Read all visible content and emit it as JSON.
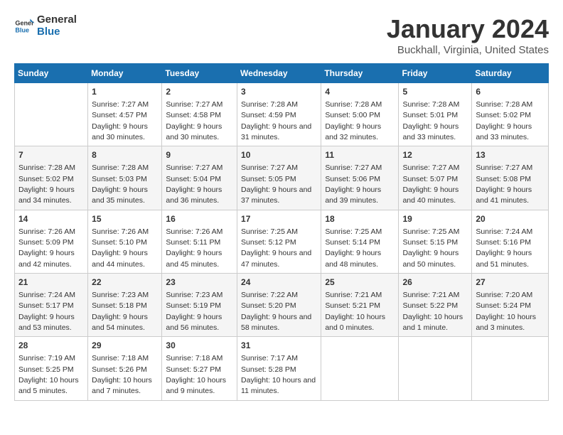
{
  "header": {
    "logo_line1": "General",
    "logo_line2": "Blue",
    "title": "January 2024",
    "subtitle": "Buckhall, Virginia, United States"
  },
  "calendar": {
    "weekdays": [
      "Sunday",
      "Monday",
      "Tuesday",
      "Wednesday",
      "Thursday",
      "Friday",
      "Saturday"
    ],
    "weeks": [
      [
        {
          "day": "",
          "sunrise": "",
          "sunset": "",
          "daylight": ""
        },
        {
          "day": "1",
          "sunrise": "Sunrise: 7:27 AM",
          "sunset": "Sunset: 4:57 PM",
          "daylight": "Daylight: 9 hours and 30 minutes."
        },
        {
          "day": "2",
          "sunrise": "Sunrise: 7:27 AM",
          "sunset": "Sunset: 4:58 PM",
          "daylight": "Daylight: 9 hours and 30 minutes."
        },
        {
          "day": "3",
          "sunrise": "Sunrise: 7:28 AM",
          "sunset": "Sunset: 4:59 PM",
          "daylight": "Daylight: 9 hours and 31 minutes."
        },
        {
          "day": "4",
          "sunrise": "Sunrise: 7:28 AM",
          "sunset": "Sunset: 5:00 PM",
          "daylight": "Daylight: 9 hours and 32 minutes."
        },
        {
          "day": "5",
          "sunrise": "Sunrise: 7:28 AM",
          "sunset": "Sunset: 5:01 PM",
          "daylight": "Daylight: 9 hours and 33 minutes."
        },
        {
          "day": "6",
          "sunrise": "Sunrise: 7:28 AM",
          "sunset": "Sunset: 5:02 PM",
          "daylight": "Daylight: 9 hours and 33 minutes."
        }
      ],
      [
        {
          "day": "7",
          "sunrise": "Sunrise: 7:28 AM",
          "sunset": "Sunset: 5:02 PM",
          "daylight": "Daylight: 9 hours and 34 minutes."
        },
        {
          "day": "8",
          "sunrise": "Sunrise: 7:28 AM",
          "sunset": "Sunset: 5:03 PM",
          "daylight": "Daylight: 9 hours and 35 minutes."
        },
        {
          "day": "9",
          "sunrise": "Sunrise: 7:27 AM",
          "sunset": "Sunset: 5:04 PM",
          "daylight": "Daylight: 9 hours and 36 minutes."
        },
        {
          "day": "10",
          "sunrise": "Sunrise: 7:27 AM",
          "sunset": "Sunset: 5:05 PM",
          "daylight": "Daylight: 9 hours and 37 minutes."
        },
        {
          "day": "11",
          "sunrise": "Sunrise: 7:27 AM",
          "sunset": "Sunset: 5:06 PM",
          "daylight": "Daylight: 9 hours and 39 minutes."
        },
        {
          "day": "12",
          "sunrise": "Sunrise: 7:27 AM",
          "sunset": "Sunset: 5:07 PM",
          "daylight": "Daylight: 9 hours and 40 minutes."
        },
        {
          "day": "13",
          "sunrise": "Sunrise: 7:27 AM",
          "sunset": "Sunset: 5:08 PM",
          "daylight": "Daylight: 9 hours and 41 minutes."
        }
      ],
      [
        {
          "day": "14",
          "sunrise": "Sunrise: 7:26 AM",
          "sunset": "Sunset: 5:09 PM",
          "daylight": "Daylight: 9 hours and 42 minutes."
        },
        {
          "day": "15",
          "sunrise": "Sunrise: 7:26 AM",
          "sunset": "Sunset: 5:10 PM",
          "daylight": "Daylight: 9 hours and 44 minutes."
        },
        {
          "day": "16",
          "sunrise": "Sunrise: 7:26 AM",
          "sunset": "Sunset: 5:11 PM",
          "daylight": "Daylight: 9 hours and 45 minutes."
        },
        {
          "day": "17",
          "sunrise": "Sunrise: 7:25 AM",
          "sunset": "Sunset: 5:12 PM",
          "daylight": "Daylight: 9 hours and 47 minutes."
        },
        {
          "day": "18",
          "sunrise": "Sunrise: 7:25 AM",
          "sunset": "Sunset: 5:14 PM",
          "daylight": "Daylight: 9 hours and 48 minutes."
        },
        {
          "day": "19",
          "sunrise": "Sunrise: 7:25 AM",
          "sunset": "Sunset: 5:15 PM",
          "daylight": "Daylight: 9 hours and 50 minutes."
        },
        {
          "day": "20",
          "sunrise": "Sunrise: 7:24 AM",
          "sunset": "Sunset: 5:16 PM",
          "daylight": "Daylight: 9 hours and 51 minutes."
        }
      ],
      [
        {
          "day": "21",
          "sunrise": "Sunrise: 7:24 AM",
          "sunset": "Sunset: 5:17 PM",
          "daylight": "Daylight: 9 hours and 53 minutes."
        },
        {
          "day": "22",
          "sunrise": "Sunrise: 7:23 AM",
          "sunset": "Sunset: 5:18 PM",
          "daylight": "Daylight: 9 hours and 54 minutes."
        },
        {
          "day": "23",
          "sunrise": "Sunrise: 7:23 AM",
          "sunset": "Sunset: 5:19 PM",
          "daylight": "Daylight: 9 hours and 56 minutes."
        },
        {
          "day": "24",
          "sunrise": "Sunrise: 7:22 AM",
          "sunset": "Sunset: 5:20 PM",
          "daylight": "Daylight: 9 hours and 58 minutes."
        },
        {
          "day": "25",
          "sunrise": "Sunrise: 7:21 AM",
          "sunset": "Sunset: 5:21 PM",
          "daylight": "Daylight: 10 hours and 0 minutes."
        },
        {
          "day": "26",
          "sunrise": "Sunrise: 7:21 AM",
          "sunset": "Sunset: 5:22 PM",
          "daylight": "Daylight: 10 hours and 1 minute."
        },
        {
          "day": "27",
          "sunrise": "Sunrise: 7:20 AM",
          "sunset": "Sunset: 5:24 PM",
          "daylight": "Daylight: 10 hours and 3 minutes."
        }
      ],
      [
        {
          "day": "28",
          "sunrise": "Sunrise: 7:19 AM",
          "sunset": "Sunset: 5:25 PM",
          "daylight": "Daylight: 10 hours and 5 minutes."
        },
        {
          "day": "29",
          "sunrise": "Sunrise: 7:18 AM",
          "sunset": "Sunset: 5:26 PM",
          "daylight": "Daylight: 10 hours and 7 minutes."
        },
        {
          "day": "30",
          "sunrise": "Sunrise: 7:18 AM",
          "sunset": "Sunset: 5:27 PM",
          "daylight": "Daylight: 10 hours and 9 minutes."
        },
        {
          "day": "31",
          "sunrise": "Sunrise: 7:17 AM",
          "sunset": "Sunset: 5:28 PM",
          "daylight": "Daylight: 10 hours and 11 minutes."
        },
        {
          "day": "",
          "sunrise": "",
          "sunset": "",
          "daylight": ""
        },
        {
          "day": "",
          "sunrise": "",
          "sunset": "",
          "daylight": ""
        },
        {
          "day": "",
          "sunrise": "",
          "sunset": "",
          "daylight": ""
        }
      ]
    ]
  }
}
